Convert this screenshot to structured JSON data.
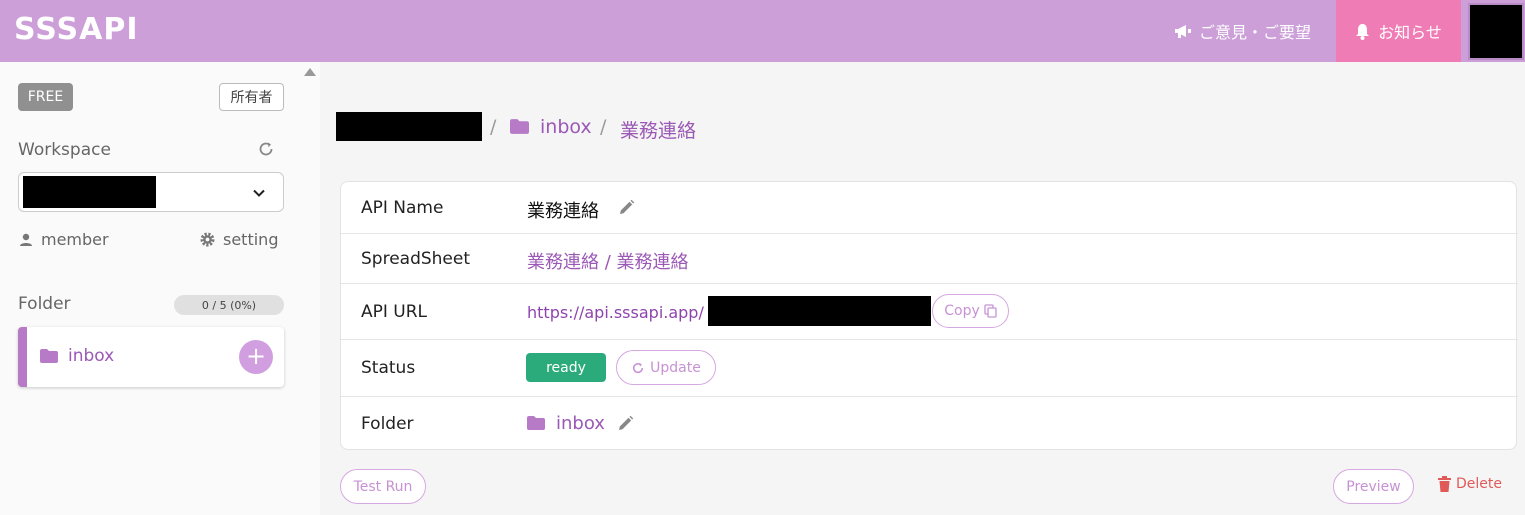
{
  "header": {
    "logo": "SSSAPI",
    "feedback_label": "ご意見・ご要望",
    "notice_label": "お知らせ"
  },
  "sidebar": {
    "plan": "FREE",
    "role": "所有者",
    "workspace_label": "Workspace",
    "member_label": "member",
    "setting_label": "setting",
    "folder_label": "Folder",
    "folder_count": "0 / 5 (0%)",
    "folders": [
      {
        "name": "inbox"
      }
    ],
    "add_label": "+"
  },
  "breadcrumb": {
    "sep1": "/",
    "folder": "inbox",
    "sep2": "/",
    "current": "業務連絡"
  },
  "details": {
    "api_name_label": "API Name",
    "api_name": "業務連絡",
    "spreadsheet_label": "SpreadSheet",
    "spreadsheet": "業務連絡 / 業務連絡",
    "api_url_label": "API URL",
    "api_url": "https://api.sssapi.app/",
    "copy_label": "Copy",
    "status_label": "Status",
    "status": "ready",
    "update_label": "Update",
    "folder_label": "Folder",
    "folder": "inbox"
  },
  "actions": {
    "test_run": "Test Run",
    "preview": "Preview",
    "delete": "Delete"
  },
  "colors": {
    "header_bg": "#cc9fd8",
    "notice_bg": "#f07cb5",
    "accent": "#9b59b6",
    "status_ready": "#2bab7b",
    "danger": "#e05a5a"
  }
}
